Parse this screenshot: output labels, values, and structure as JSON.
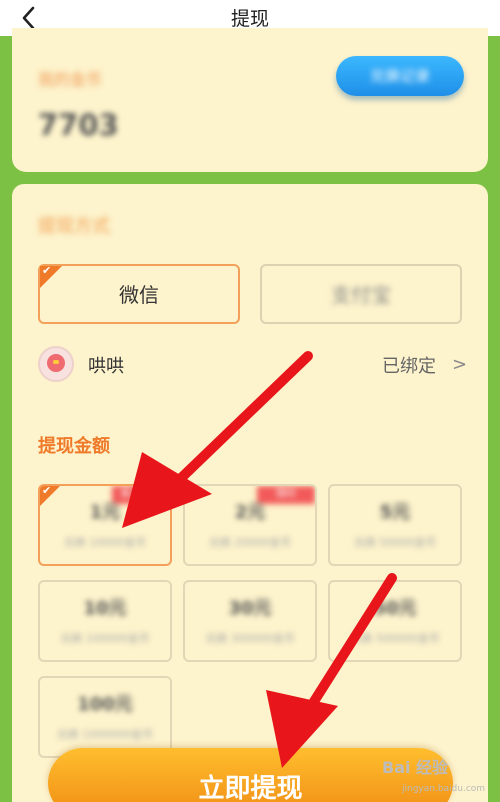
{
  "header": {
    "title": "提现"
  },
  "coins": {
    "label": "我的金币",
    "value": "7703",
    "exchange_button": "兑换记录"
  },
  "payment": {
    "section_label": "提现方式",
    "options": [
      {
        "label": "微信",
        "selected": true
      },
      {
        "label": "支付宝",
        "selected": false
      }
    ],
    "account": {
      "name": "哄哄",
      "status": "已绑定"
    }
  },
  "amount": {
    "section_label": "提现金额",
    "options": [
      {
        "value": "1元",
        "sub": "兑换 10000金币",
        "badge": "新人专享",
        "selected": true
      },
      {
        "value": "2元",
        "sub": "兑换 20000金币",
        "badge": "限时",
        "selected": false
      },
      {
        "value": "5元",
        "sub": "兑换 50000金币",
        "badge": "",
        "selected": false
      },
      {
        "value": "10元",
        "sub": "兑换 100000金币",
        "badge": "",
        "selected": false
      },
      {
        "value": "30元",
        "sub": "兑换 300000金币",
        "badge": "",
        "selected": false
      },
      {
        "value": "50元",
        "sub": "兑换 500000金币",
        "badge": "",
        "selected": false
      },
      {
        "value": "100元",
        "sub": "兑换 1000000金币",
        "badge": "",
        "selected": false
      }
    ]
  },
  "submit_button": "立即提现",
  "watermark": {
    "text": "Bai 经验",
    "sub": "jingyan.baidu.com"
  },
  "colors": {
    "accent": "#ee7a2a",
    "card_bg": "#fdf3cc",
    "page_bg": "#7cc143",
    "annotation": "#e8161b"
  }
}
